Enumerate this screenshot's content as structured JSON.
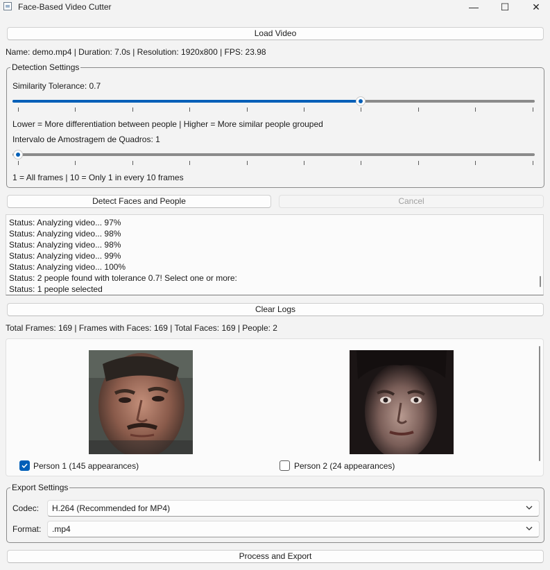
{
  "window": {
    "title": "Face-Based Video Cutter",
    "controls": [
      "—",
      "☐",
      "✕"
    ]
  },
  "load_button": "Load Video",
  "video_info": "Name: demo.mp4 | Duration: 7.0s | Resolution: 1920x800 | FPS: 23.98",
  "detection": {
    "group_title": "Detection Settings",
    "tolerance_label": "Similarity Tolerance: 0.7",
    "tolerance_value": 0.7,
    "tolerance_hint": "Lower = More differentiation between people | Higher = More similar people grouped",
    "interval_label": "Intervalo de Amostragem de Quadros: 1",
    "interval_value": 1,
    "interval_hint": "1 = All frames | 10 = Only 1 in every 10 frames"
  },
  "detect_button": "Detect Faces and People",
  "cancel_button": "Cancel",
  "logs": [
    "Status: Analyzing video... 97%",
    "Status: Analyzing video... 98%",
    "Status: Analyzing video... 98%",
    "Status: Analyzing video... 99%",
    "Status: Analyzing video... 100%",
    "Status: 2 people found with tolerance 0.7! Select one or more:",
    "Status: 1 people selected"
  ],
  "clear_logs_button": "Clear Logs",
  "stats": "Total Frames: 169 | Frames with Faces: 169 | Total Faces: 169 | People: 2",
  "people": [
    {
      "label": "Person 1 (145 appearances)",
      "checked": true
    },
    {
      "label": "Person 2 (24 appearances)",
      "checked": false
    }
  ],
  "export": {
    "group_title": "Export Settings",
    "codec_label": "Codec:",
    "codec_value": "H.264 (Recommended for MP4)",
    "format_label": "Format:",
    "format_value": ".mp4"
  },
  "process_button": "Process and Export",
  "colors": {
    "accent": "#005fb8",
    "background": "#f3f3f3"
  }
}
